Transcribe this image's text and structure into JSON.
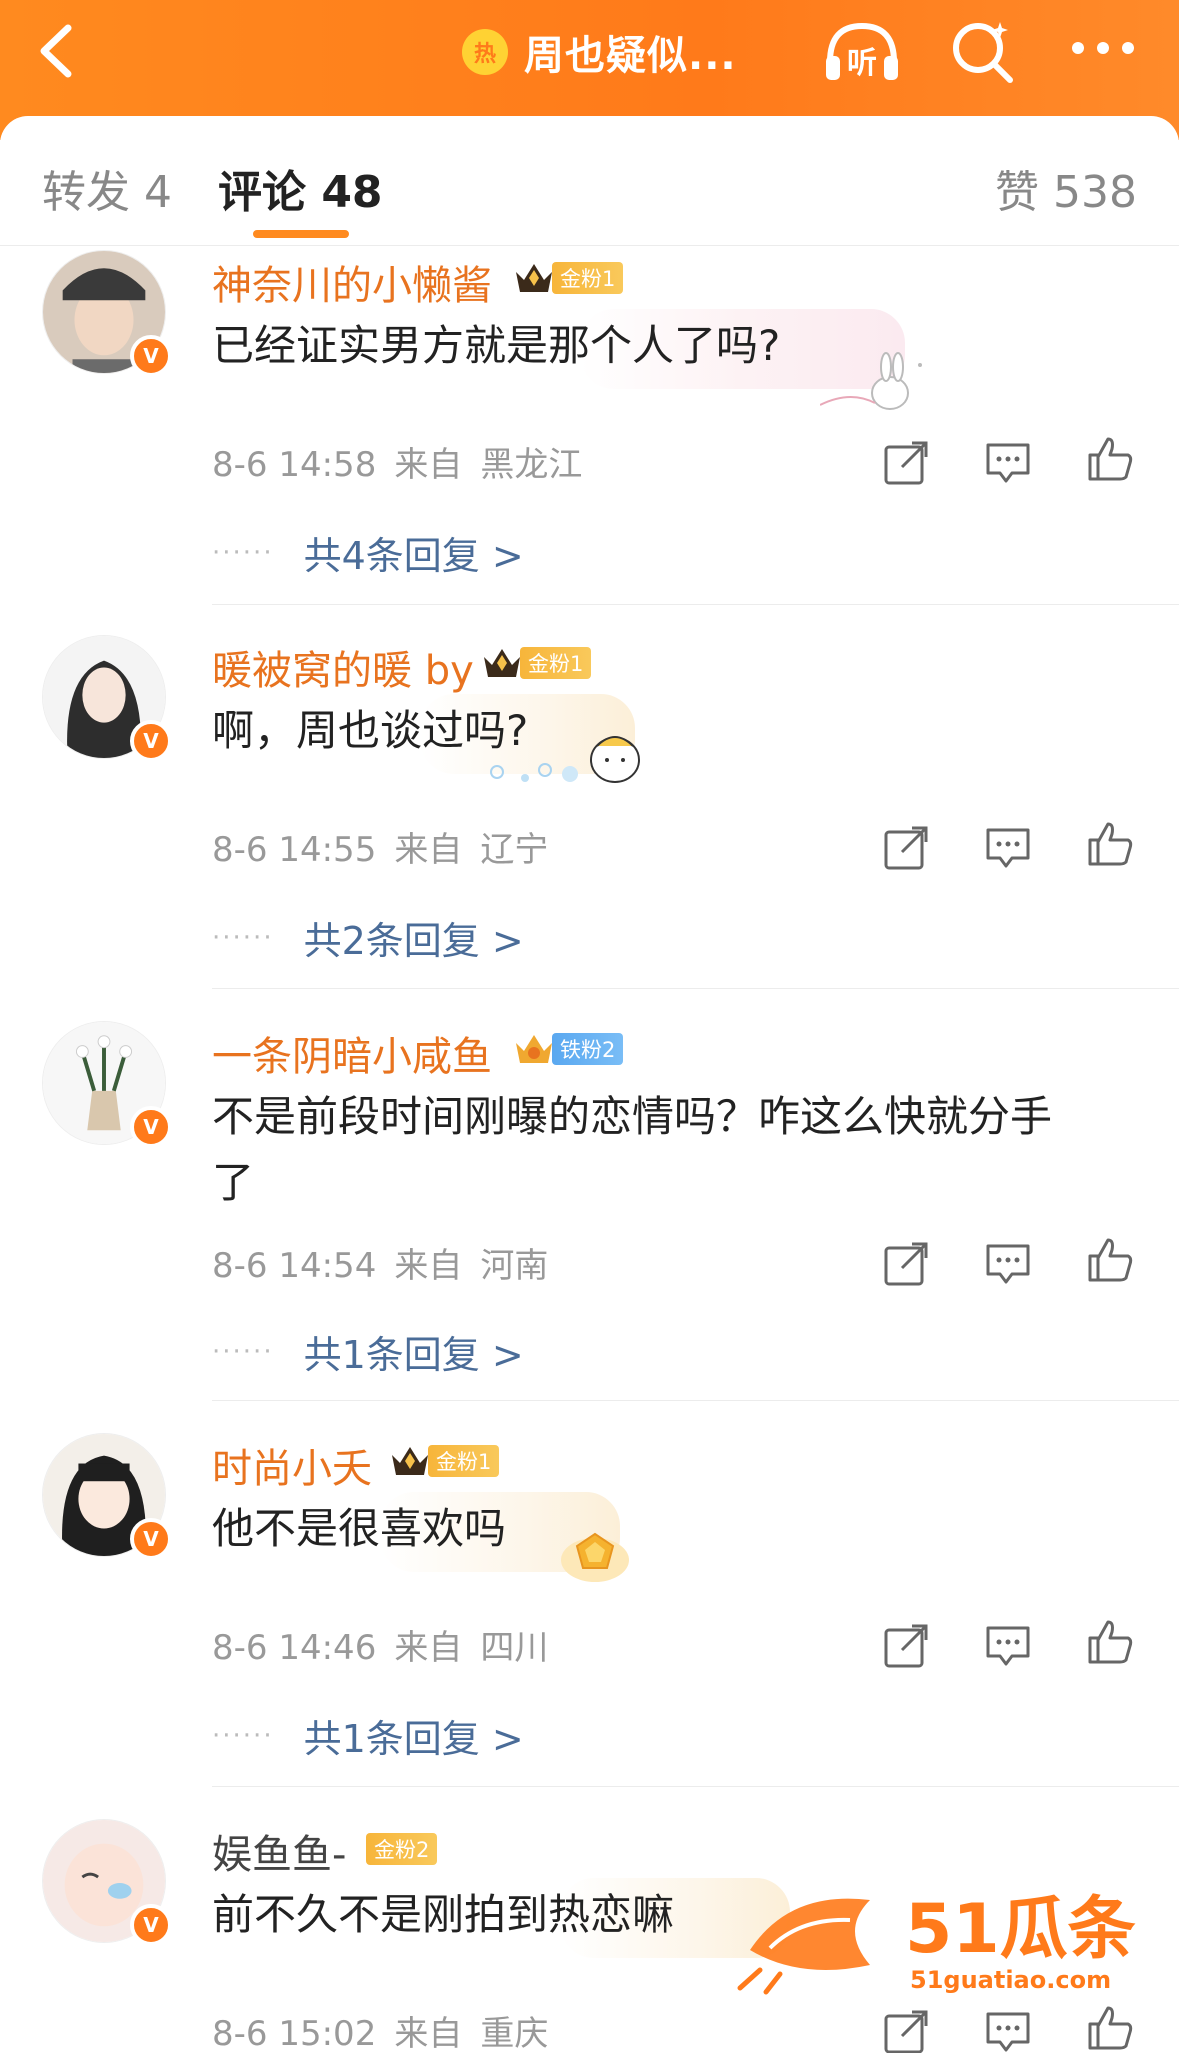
{
  "header": {
    "title": "周也疑似...",
    "hot_badge": "热",
    "listen_label": "听"
  },
  "tabs": {
    "repost": "转发 4",
    "comments": "评论 48",
    "likes": "赞 538"
  },
  "comments": [
    {
      "username": "神奈川的小懒酱",
      "fan_badge": "金粉1",
      "text": "已经证实男方就是那个人了吗?",
      "date": "8-6 14:58",
      "from": "来自",
      "location": "黑龙江",
      "replies": "共4条回复 >"
    },
    {
      "username": "暖被窝的暖 by",
      "fan_badge": "金粉1",
      "text": "啊，周也谈过吗?",
      "date": "8-6 14:55",
      "from": "来自",
      "location": "辽宁",
      "replies": "共2条回复 >"
    },
    {
      "username": "一条阴暗小咸鱼",
      "fan_badge": "铁粉2",
      "text_line1": "不是前段时间刚曝的恋情吗？咋这么快就分手",
      "text_line2": "了",
      "date": "8-6 14:54",
      "from": "来自",
      "location": "河南",
      "replies": "共1条回复 >"
    },
    {
      "username": "时尚小夭",
      "fan_badge": "金粉1",
      "text": "他不是很喜欢吗",
      "date": "8-6 14:46",
      "from": "来自",
      "location": "四川",
      "replies": "共1条回复 >"
    },
    {
      "username": "娱鱼鱼-",
      "fan_badge": "金粉2",
      "text": "前不久不是刚拍到热恋嘛",
      "date": "8-6 15:02",
      "from": "来自",
      "location": "重庆"
    }
  ],
  "watermark": {
    "brand": "51瓜条",
    "url": "51guatiao.com"
  },
  "colors": {
    "header_orange": "#ff7a1a",
    "username_orange": "#e8731f",
    "reply_link_blue": "#4a6c98",
    "meta_gray": "#999999"
  },
  "icons": [
    "back-arrow-icon",
    "hot-icon",
    "headphones-icon",
    "search-icon",
    "more-icon",
    "share-icon",
    "comment-icon",
    "like-icon",
    "verified-icon",
    "crown-icon"
  ]
}
